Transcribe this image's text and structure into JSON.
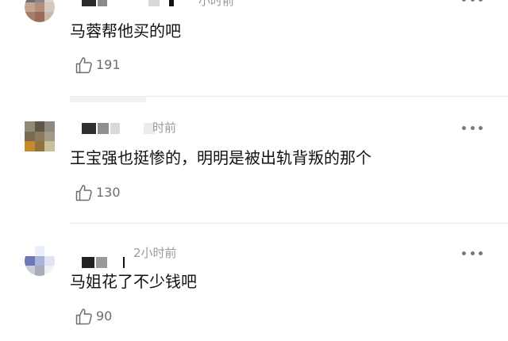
{
  "comments": [
    {
      "time": "小时前",
      "text": "马蓉帮他买的吧",
      "likes": "191",
      "avatar_colors": [
        "#6f6a80",
        "#8a8490",
        "#d9d4d0",
        "#c2a48f",
        "#b58e7a",
        "#d7c8be",
        "#a77c6a",
        "#9c6b58",
        "#cdb7a8"
      ]
    },
    {
      "time": "时前",
      "text": "王宝强也挺惨的，明明是被出轨背叛的那个",
      "likes": "130",
      "avatar_colors": [
        "#8e8d74",
        "#5f5646",
        "#8a8a83",
        "#7b6a52",
        "#8c7a5f",
        "#a39a86",
        "#c68a2e",
        "#8f7440",
        "#c9bf9b"
      ]
    },
    {
      "time": "2小时前",
      "text": "马姐花了不少钱吧",
      "likes": "90",
      "avatar_colors": [
        "#ffffff",
        "#e9eefb",
        "#ffffff",
        "#6f78b6",
        "#aab3d9",
        "#dfe3f2",
        "#c7ccd6",
        "#a6acb8",
        "#eef0f4"
      ]
    }
  ],
  "icons": {
    "like": "thumbs-up-icon",
    "more": "more-dots-icon"
  },
  "colors": {
    "text": "#111111",
    "meta": "#9a9a9a",
    "like_count": "#6c6c6c",
    "divider": "#ececec"
  }
}
